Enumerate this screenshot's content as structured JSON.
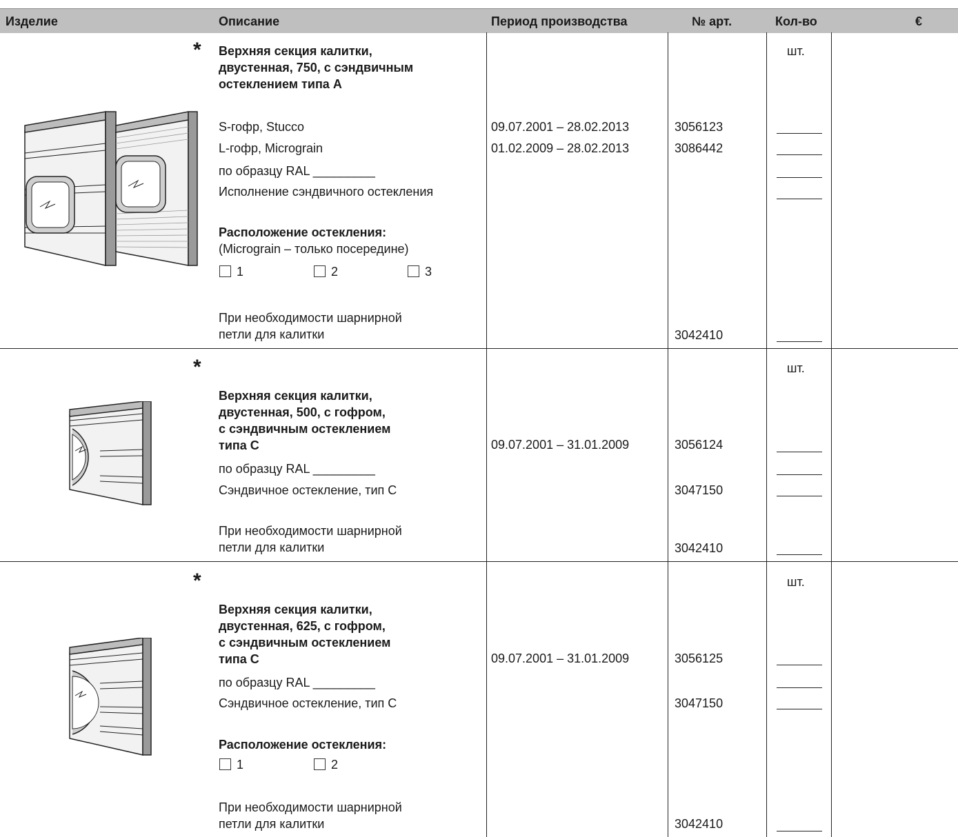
{
  "header": {
    "col_product": "Изделие",
    "col_description": "Описание",
    "col_period": "Период производства",
    "col_article": "№ арт.",
    "col_qty": "Кол-во",
    "col_price": "€"
  },
  "rows": [
    {
      "star": "*",
      "title_lines": [
        "Верхняя секция калитки,",
        "двустенная, 750, с сэндвичным",
        "остеклением типа A"
      ],
      "unit": "шт.",
      "items": [
        {
          "label": "S-гофр, Stucco",
          "period": "09.07.2001 – 28.02.2013",
          "article": "3056123"
        },
        {
          "label": "L-гофр, Micrograin",
          "period": "01.02.2009 – 28.02.2013",
          "article": "3086442"
        },
        {
          "label": "по образцу RAL _________",
          "period": "",
          "article": ""
        },
        {
          "label": "Исполнение сэндвичного остекления",
          "period": "",
          "article": ""
        }
      ],
      "placement_title": "Расположение остекления:",
      "placement_note": "(Micrograin – только посередине)",
      "placement_options": [
        "1",
        "2",
        "3"
      ],
      "hinge_lines": [
        "При необходимости шарнирной",
        "петли для калитки"
      ],
      "hinge_article": "3042410"
    },
    {
      "star": "*",
      "title_lines": [
        "Верхняя секция калитки,",
        "двустенная, 500, с гофром,",
        "с сэндвичным остеклением",
        "типа C"
      ],
      "unit": "шт.",
      "period": "09.07.2001 – 31.01.2009",
      "article": "3056124",
      "items": [
        {
          "label": "по образцу RAL _________",
          "article": ""
        },
        {
          "label": "Сэндвичное остекление, тип C",
          "article": "3047150"
        }
      ],
      "hinge_lines": [
        "При необходимости шарнирной",
        "петли для калитки"
      ],
      "hinge_article": "3042410"
    },
    {
      "star": "*",
      "title_lines": [
        "Верхняя секция калитки,",
        "двустенная, 625, с гофром,",
        "с сэндвичным остеклением",
        "типа C"
      ],
      "unit": "шт.",
      "period": "09.07.2001 – 31.01.2009",
      "article": "3056125",
      "items": [
        {
          "label": "по образцу RAL _________",
          "article": ""
        },
        {
          "label": "Сэндвичное остекление, тип C",
          "article": "3047150"
        }
      ],
      "placement_title": "Расположение остекления:",
      "placement_options": [
        "1",
        "2"
      ],
      "hinge_lines": [
        "При необходимости шарнирной",
        "петли для калитки"
      ],
      "hinge_article": "3042410"
    }
  ]
}
